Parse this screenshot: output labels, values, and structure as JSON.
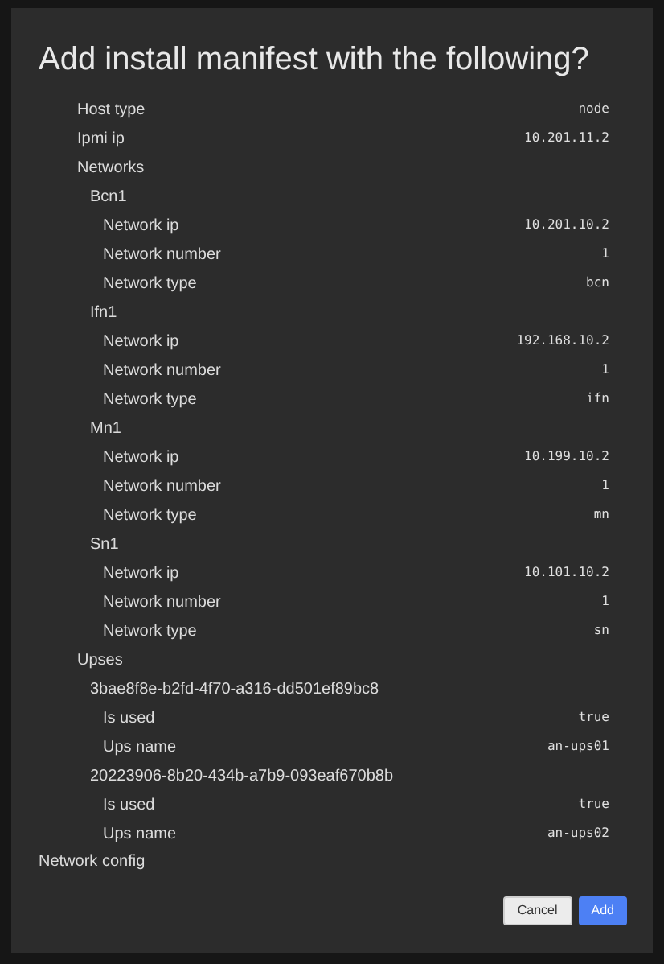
{
  "dialog": {
    "title": "Add install manifest with the following?",
    "entries": [
      {
        "label": "Host type",
        "value": "node"
      },
      {
        "label": "Ipmi ip",
        "value": "10.201.11.2"
      },
      {
        "label": "Networks",
        "children": [
          {
            "label": "Bcn1",
            "children": [
              {
                "label": "Network ip",
                "value": "10.201.10.2"
              },
              {
                "label": "Network number",
                "value": "1"
              },
              {
                "label": "Network type",
                "value": "bcn"
              }
            ]
          },
          {
            "label": "Ifn1",
            "children": [
              {
                "label": "Network ip",
                "value": "192.168.10.2"
              },
              {
                "label": "Network number",
                "value": "1"
              },
              {
                "label": "Network type",
                "value": "ifn"
              }
            ]
          },
          {
            "label": "Mn1",
            "children": [
              {
                "label": "Network ip",
                "value": "10.199.10.2"
              },
              {
                "label": "Network number",
                "value": "1"
              },
              {
                "label": "Network type",
                "value": "mn"
              }
            ]
          },
          {
            "label": "Sn1",
            "children": [
              {
                "label": "Network ip",
                "value": "10.101.10.2"
              },
              {
                "label": "Network number",
                "value": "1"
              },
              {
                "label": "Network type",
                "value": "sn"
              }
            ]
          }
        ]
      },
      {
        "label": "Upses",
        "children": [
          {
            "label": "3bae8f8e-b2fd-4f70-a316-dd501ef89bc8",
            "children": [
              {
                "label": "Is used",
                "value": "true"
              },
              {
                "label": "Ups name",
                "value": "an-ups01"
              }
            ]
          },
          {
            "label": "20223906-8b20-434b-a7b9-093eaf670b8b",
            "children": [
              {
                "label": "Is used",
                "value": "true"
              },
              {
                "label": "Ups name",
                "value": "an-ups02"
              }
            ]
          }
        ]
      }
    ],
    "section_label": "Network config",
    "buttons": [
      {
        "label": "Cancel",
        "kind": "secondary"
      },
      {
        "label": "Add",
        "kind": "primary"
      }
    ]
  }
}
